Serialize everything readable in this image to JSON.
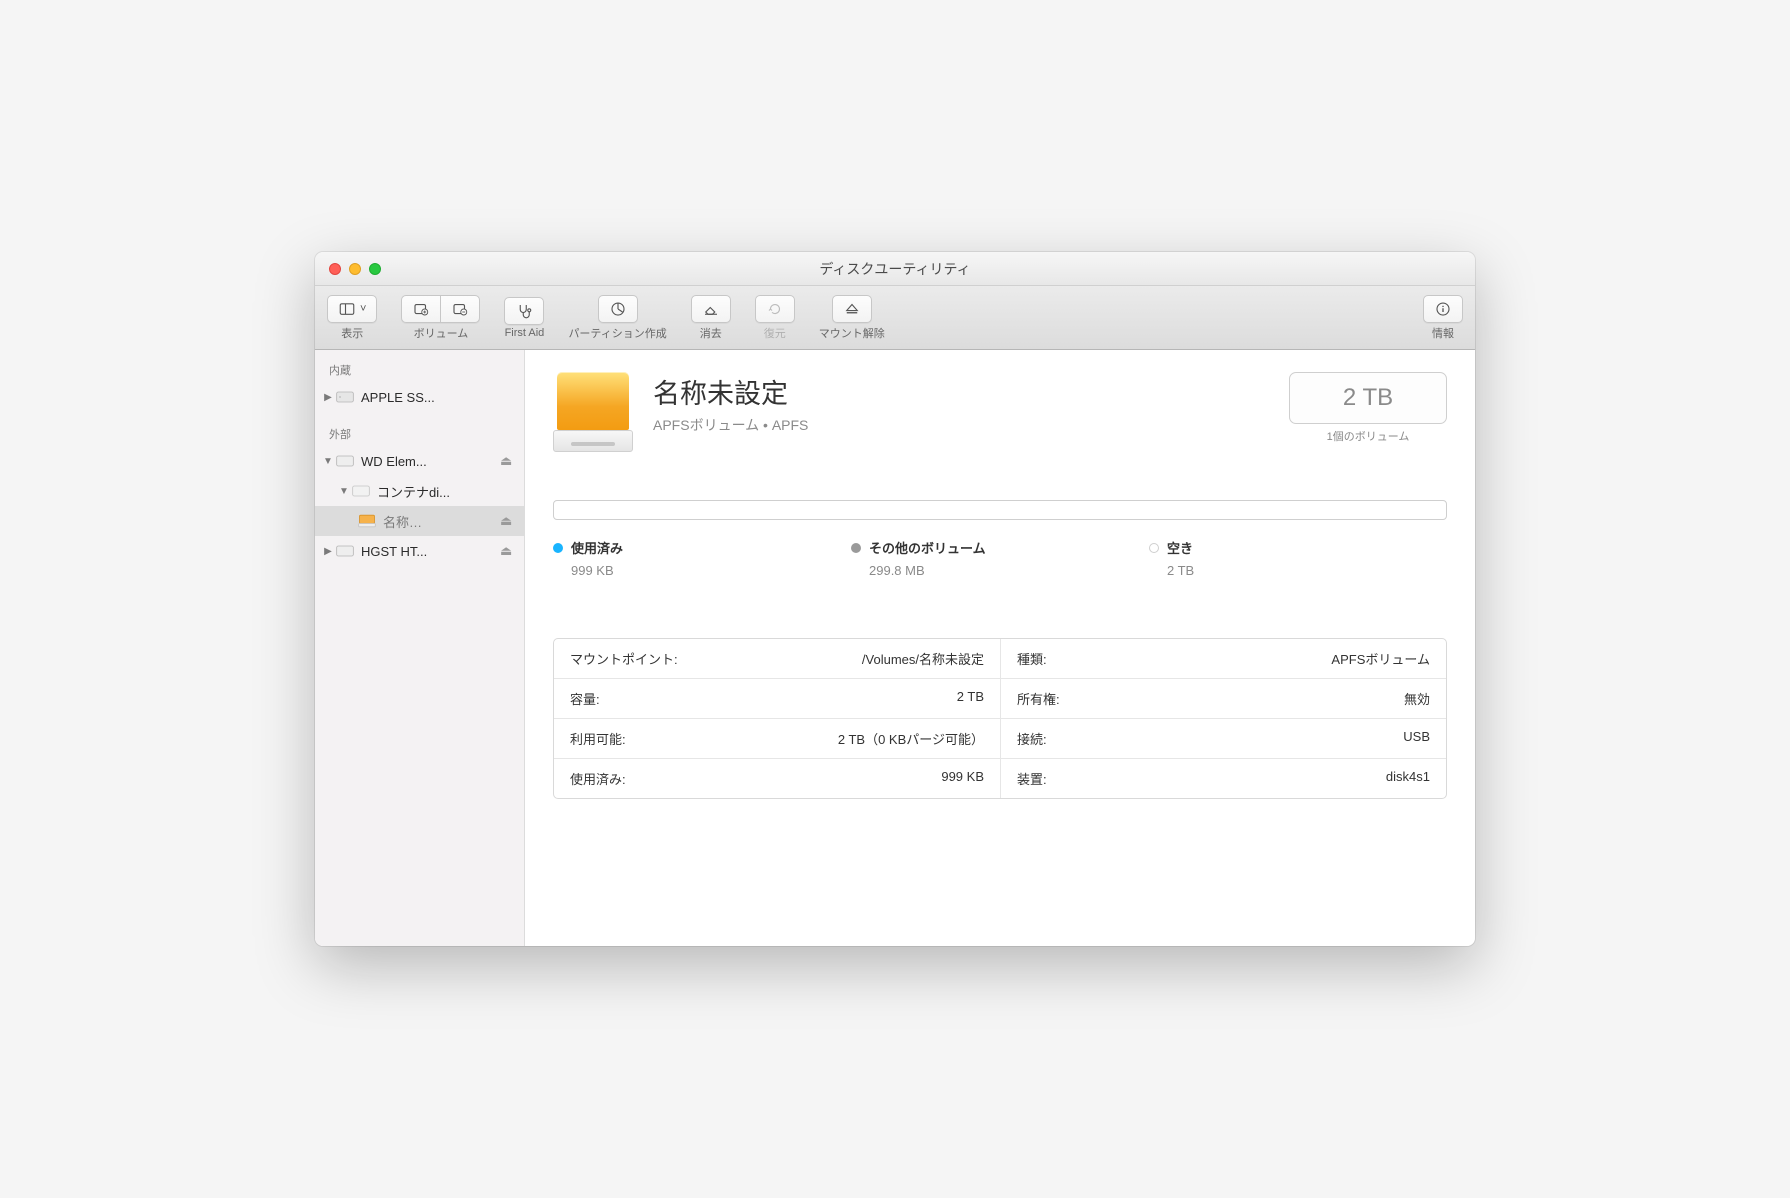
{
  "window": {
    "title": "ディスクユーティリティ"
  },
  "toolbar": {
    "view": "表示",
    "volume": "ボリューム",
    "firstaid": "First Aid",
    "partition": "パーティション作成",
    "erase": "消去",
    "restore": "復元",
    "unmount": "マウント解除",
    "info": "情報"
  },
  "sidebar": {
    "internal_heading": "内蔵",
    "external_heading": "外部",
    "items": {
      "apple_ssd": "APPLE SS...",
      "wd": "WD Elem...",
      "container": "コンテナdi...",
      "untitled": "名称…",
      "hgst": "HGST HT..."
    }
  },
  "volume": {
    "name": "名称未設定",
    "subtitle": "APFSボリューム • APFS",
    "capacity": "2 TB",
    "capacity_sub": "1個のボリューム"
  },
  "legend": {
    "used_label": "使用済み",
    "used_value": "999 KB",
    "other_label": "その他のボリューム",
    "other_value": "299.8 MB",
    "free_label": "空き",
    "free_value": "2 TB"
  },
  "info": {
    "mount_point_label": "マウントポイント:",
    "mount_point_value": "/Volumes/名称未設定",
    "type_label": "種類:",
    "type_value": "APFSボリューム",
    "capacity_label": "容量:",
    "capacity_value": "2 TB",
    "owners_label": "所有権:",
    "owners_value": "無効",
    "available_label": "利用可能:",
    "available_value": "2 TB（0 KBパージ可能）",
    "connection_label": "接続:",
    "connection_value": "USB",
    "used_label": "使用済み:",
    "used_value": "999 KB",
    "device_label": "装置:",
    "device_value": "disk4s1"
  }
}
